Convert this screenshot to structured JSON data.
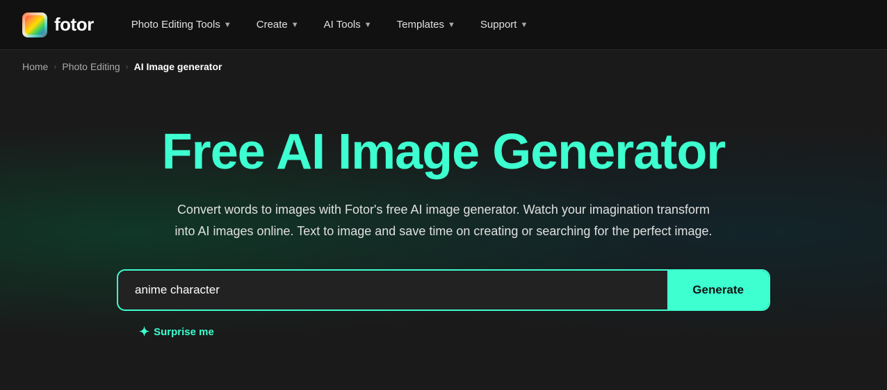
{
  "logo": {
    "text": "fotor",
    "icon": "🎨"
  },
  "nav": {
    "items": [
      {
        "label": "Photo Editing Tools",
        "has_chevron": true
      },
      {
        "label": "Create",
        "has_chevron": true
      },
      {
        "label": "AI Tools",
        "has_chevron": true
      },
      {
        "label": "Templates",
        "has_chevron": true
      },
      {
        "label": "Support",
        "has_chevron": true
      }
    ]
  },
  "breadcrumb": {
    "items": [
      {
        "label": "Home",
        "is_link": true
      },
      {
        "label": "Photo Editing",
        "is_link": true
      },
      {
        "label": "AI Image generator",
        "is_link": false
      }
    ]
  },
  "hero": {
    "title": "Free AI Image Generator",
    "subtitle": "Convert words to images with Fotor's free AI image generator. Watch your imagination transform into AI images online. Text to image and save time on creating or searching for the perfect image.",
    "input_placeholder": "anime character",
    "generate_label": "Generate",
    "surprise_label": "Surprise me"
  },
  "colors": {
    "accent": "#3dffd0",
    "nav_bg": "#111111",
    "body_bg": "#1a1a1a"
  }
}
